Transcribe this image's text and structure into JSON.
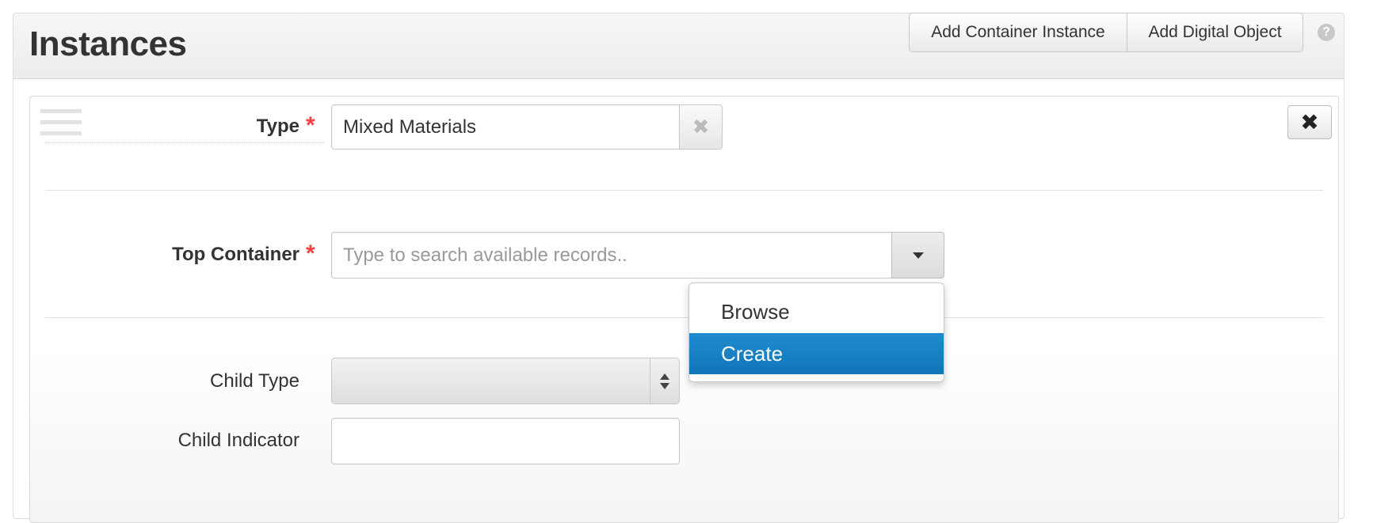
{
  "section": {
    "title": "Instances",
    "add_container_label": "Add Container Instance",
    "add_digital_label": "Add Digital Object",
    "help_glyph": "?"
  },
  "fields": {
    "type_label": "Type",
    "type_value": "Mixed Materials",
    "top_container_label": "Top Container",
    "top_container_placeholder": "Type to search available records..",
    "child_type_label": "Child Type",
    "child_indicator_label": "Child Indicator",
    "required_marker": "*"
  },
  "menu": {
    "items": [
      {
        "label": "Browse",
        "active": false
      },
      {
        "label": "Create",
        "active": true
      }
    ]
  },
  "icons": {
    "clear": "times-icon",
    "remove": "close-icon",
    "drag": "drag-handle-icon"
  },
  "colors": {
    "required": "#e44444",
    "menu_active": "#1a83c5"
  }
}
